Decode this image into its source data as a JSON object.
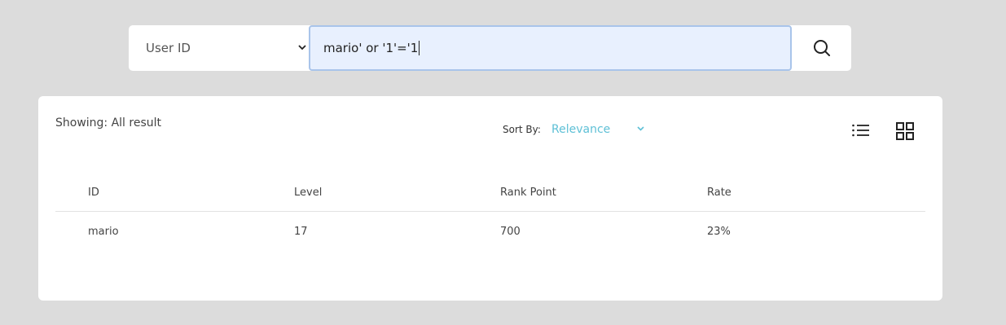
{
  "search": {
    "filter_value": "User ID",
    "query": "mario' or '1'='1"
  },
  "results": {
    "showing": "Showing: All result",
    "sort_label": "Sort By:",
    "sort_value": "Relevance",
    "columns": [
      "ID",
      "Level",
      "Rank Point",
      "Rate"
    ],
    "rows": [
      {
        "id": "mario",
        "level": "17",
        "rank_point": "700",
        "rate": "23%"
      }
    ]
  },
  "icons": {
    "search": "search-icon",
    "filter_dropdown": "chevron-down-icon",
    "sort_dropdown": "chevron-down-icon",
    "list_view": "list-icon",
    "grid_view": "grid-icon"
  },
  "colors": {
    "page_background": "#dcdcdc",
    "input_focus_border": "#a9c4ea",
    "input_background": "#e8f0fe",
    "sort_accent": "#5ec0d6"
  }
}
